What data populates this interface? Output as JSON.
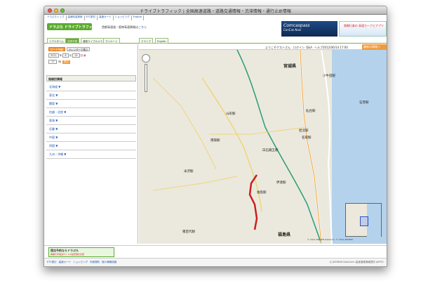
{
  "window": {
    "title": "ドライブトラフィック | 全国高速道路・道路交通情報・渋滞情報・通行止め情報"
  },
  "top_links": [
    "ドラぷらトップ",
    "高速料金検索",
    "ETC割引",
    "高速カード",
    "ショッピング",
    "English"
  ],
  "header": {
    "logo": "ドラぷら ドライブトラフィック",
    "hotline_text": "首都高速道・阪神高速情報は",
    "hotline_link": "こちら",
    "banner1_text": "Comcaspass",
    "banner1_sub": "ConCas Navi",
    "banner2_text": "満開行楽の 高速カーナビアプリ"
  },
  "tabs": [
    "リアルタイム",
    "渋滞予測",
    "道路ライブカメラ",
    "マイルート"
  ],
  "map_tabs": [
    "ドライブ",
    "English"
  ],
  "sidebar": {
    "btn_now": "ロード予報",
    "btn_calendar": "カレンダーで選ぶ",
    "date": {
      "year": "2011",
      "year_unit": "年",
      "month": "6",
      "month_unit": "月",
      "day": "14",
      "day_unit": "日"
    },
    "time": {
      "hour": "17",
      "hour_unit": "時",
      "go": "表示"
    },
    "section_title": "路線別情報",
    "regions": [
      "北海道",
      "東北",
      "関東",
      "信越・北陸",
      "東海",
      "近畿",
      "中国",
      "四国",
      "九州・沖縄"
    ]
  },
  "map_header": {
    "welcome": "ようこそゲストさん",
    "login": "ログイン",
    "faq": "Q&A",
    "help": "ヘルプ",
    "feedback": "携帯へ送信",
    "datetime": "2012/06/14 17:00",
    "reset": "最新の情報へ"
  },
  "map": {
    "cities": [
      {
        "name": "宮城県"
      },
      {
        "name": "仙台駅"
      },
      {
        "name": "山形駅"
      },
      {
        "name": "南陽駅"
      },
      {
        "name": "白石蔵王駅"
      },
      {
        "name": "名取駅"
      },
      {
        "name": "岩沼駅"
      },
      {
        "name": "米沢駅"
      },
      {
        "name": "福島駅"
      },
      {
        "name": "福島県"
      },
      {
        "name": "石巻駅"
      },
      {
        "name": "小牛田駅"
      },
      {
        "name": "猪苗代駅"
      },
      {
        "name": "伊達駅"
      }
    ],
    "copyright": "© 2012 ZENRIN DataCom, © 2012 ZENRIN"
  },
  "footer_ad": {
    "text": "宿泊予約ならドラぷら",
    "sub": "各種大手宿泊サイトの最安値を比較"
  },
  "footer": {
    "links": [
      "ETC割引",
      "高速カード",
      "ショッピング",
      "利用規約",
      "個人情報保護"
    ],
    "copyright": "(C)ZENRIN DataCom 高速道路情報提供 JARTIC"
  }
}
